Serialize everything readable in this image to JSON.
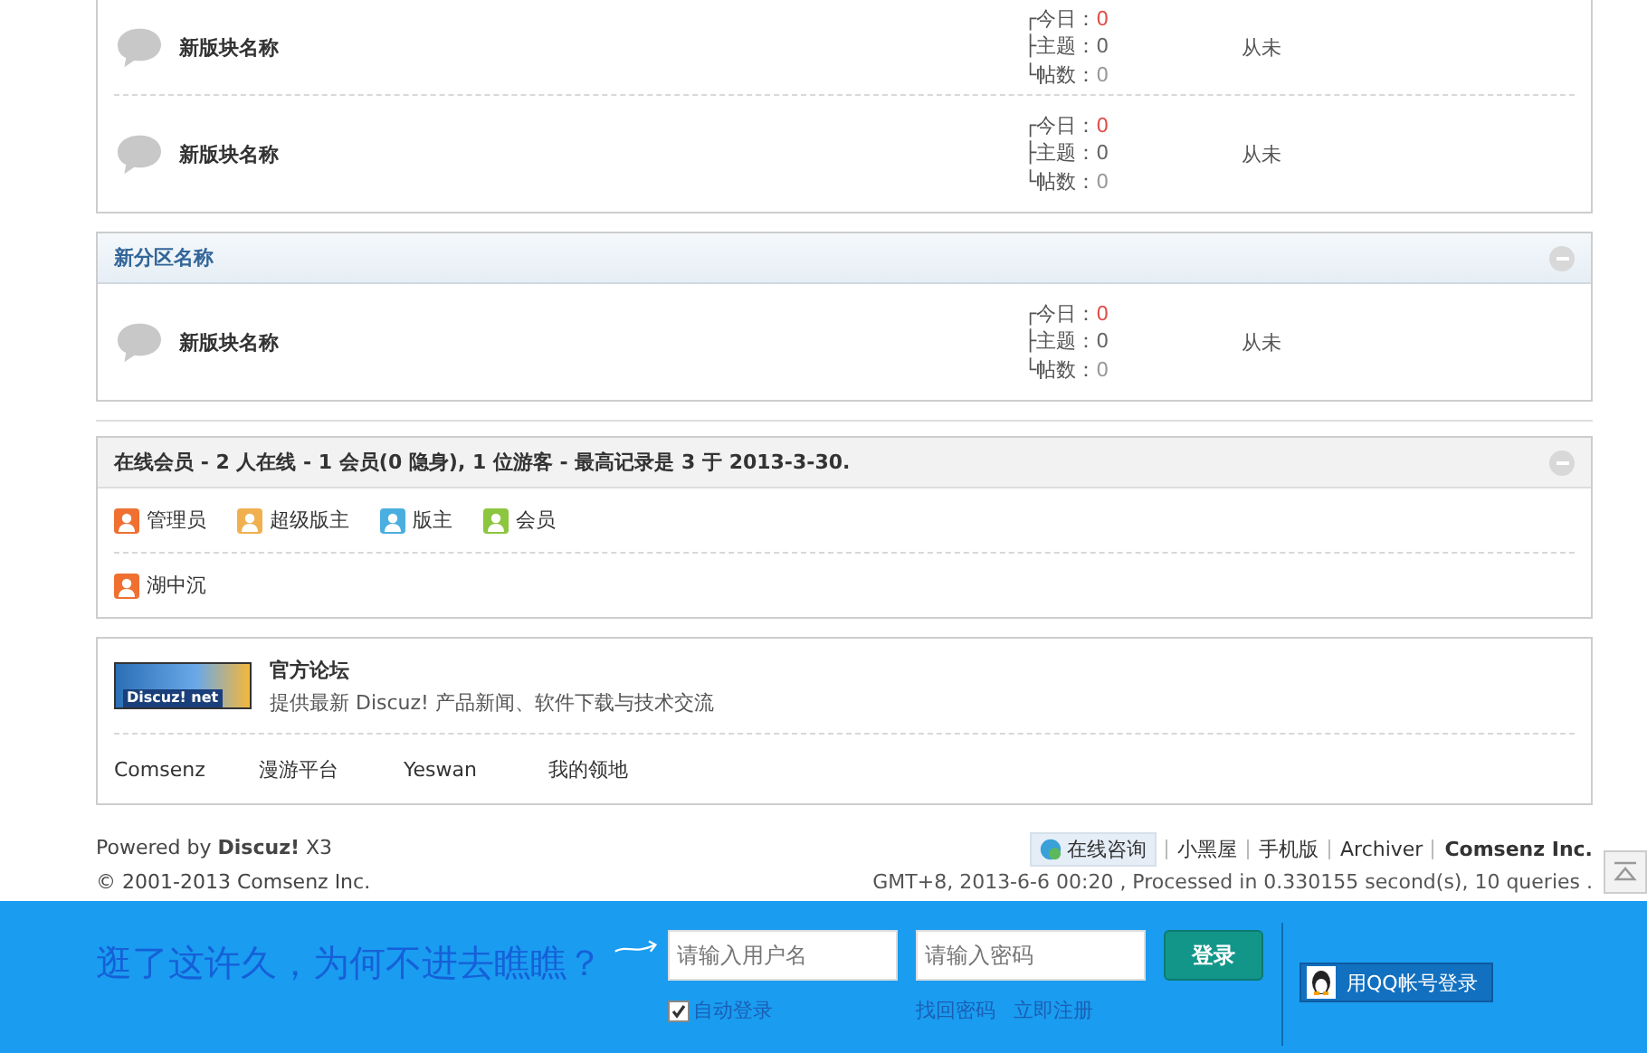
{
  "forum_list": [
    {
      "name": "新版块名称",
      "stats": [
        {
          "branch": "┌",
          "label": "今日：",
          "value": "0",
          "color": "#e0504b"
        },
        {
          "branch": "├",
          "label": "主题：",
          "value": "0",
          "color": "#666666"
        },
        {
          "branch": "└",
          "label": "帖数：",
          "value": "0",
          "color": "#999999"
        }
      ],
      "last_post": "从未"
    },
    {
      "name": "新版块名称",
      "stats": [
        {
          "branch": "┌",
          "label": "今日：",
          "value": "0",
          "color": "#e0504b"
        },
        {
          "branch": "├",
          "label": "主题：",
          "value": "0",
          "color": "#666666"
        },
        {
          "branch": "└",
          "label": "帖数：",
          "value": "0",
          "color": "#999999"
        }
      ],
      "last_post": "从未"
    }
  ],
  "category": {
    "title": "新分区名称",
    "expanded": true,
    "forums": [
      {
        "name": "新版块名称",
        "stats": [
          {
            "branch": "┌",
            "label": "今日：",
            "value": "0",
            "color": "#e0504b"
          },
          {
            "branch": "├",
            "label": "主题：",
            "value": "0",
            "color": "#666666"
          },
          {
            "branch": "└",
            "label": "帖数：",
            "value": "0",
            "color": "#999999"
          }
        ],
        "last_post": "从未"
      }
    ]
  },
  "online": {
    "title": "在线会员 - 2 人在线 - 1 会员(0 隐身), 1 位游客 - 最高记录是 3 于 2013-3-30.",
    "expanded": true,
    "legend": [
      {
        "label": "管理员",
        "color": "#ef7031"
      },
      {
        "label": "超级版主",
        "color": "#f0b050"
      },
      {
        "label": "版主",
        "color": "#4aaee0"
      },
      {
        "label": "会员",
        "color": "#8cc63e"
      }
    ],
    "users": [
      {
        "name": "湖中沉",
        "color": "#ef7031"
      }
    ]
  },
  "links": {
    "featured": {
      "logo_text": "Discuz! net",
      "title": "官方论坛",
      "description": "提供最新 Discuz! 产品新闻、软件下载与技术交流"
    },
    "items": [
      "Comsenz",
      "漫游平台",
      "Yeswan",
      "我的领地"
    ]
  },
  "footer": {
    "powered_prefix": "Powered by",
    "powered_brand": "Discuz!",
    "version": "X3",
    "copyright": "© 2001-2013 Comsenz Inc.",
    "consult": "在线咨询",
    "nav": [
      "小黑屋",
      "手机版",
      "Archiver"
    ],
    "company": "Comsenz Inc.",
    "timing": "GMT+8, 2013-6-6 00:20 , Processed in 0.330155 second(s), 10 queries ."
  },
  "login_bar": {
    "slogan": "逛了这许久，为何不进去瞧瞧？",
    "username_placeholder": "请输入用户名",
    "password_placeholder": "请输入密码",
    "login": "登录",
    "auto_login": {
      "label": "自动登录",
      "checked": true
    },
    "links": [
      "找回密码",
      "立即注册"
    ],
    "qq_login": "用QQ帐号登录"
  }
}
